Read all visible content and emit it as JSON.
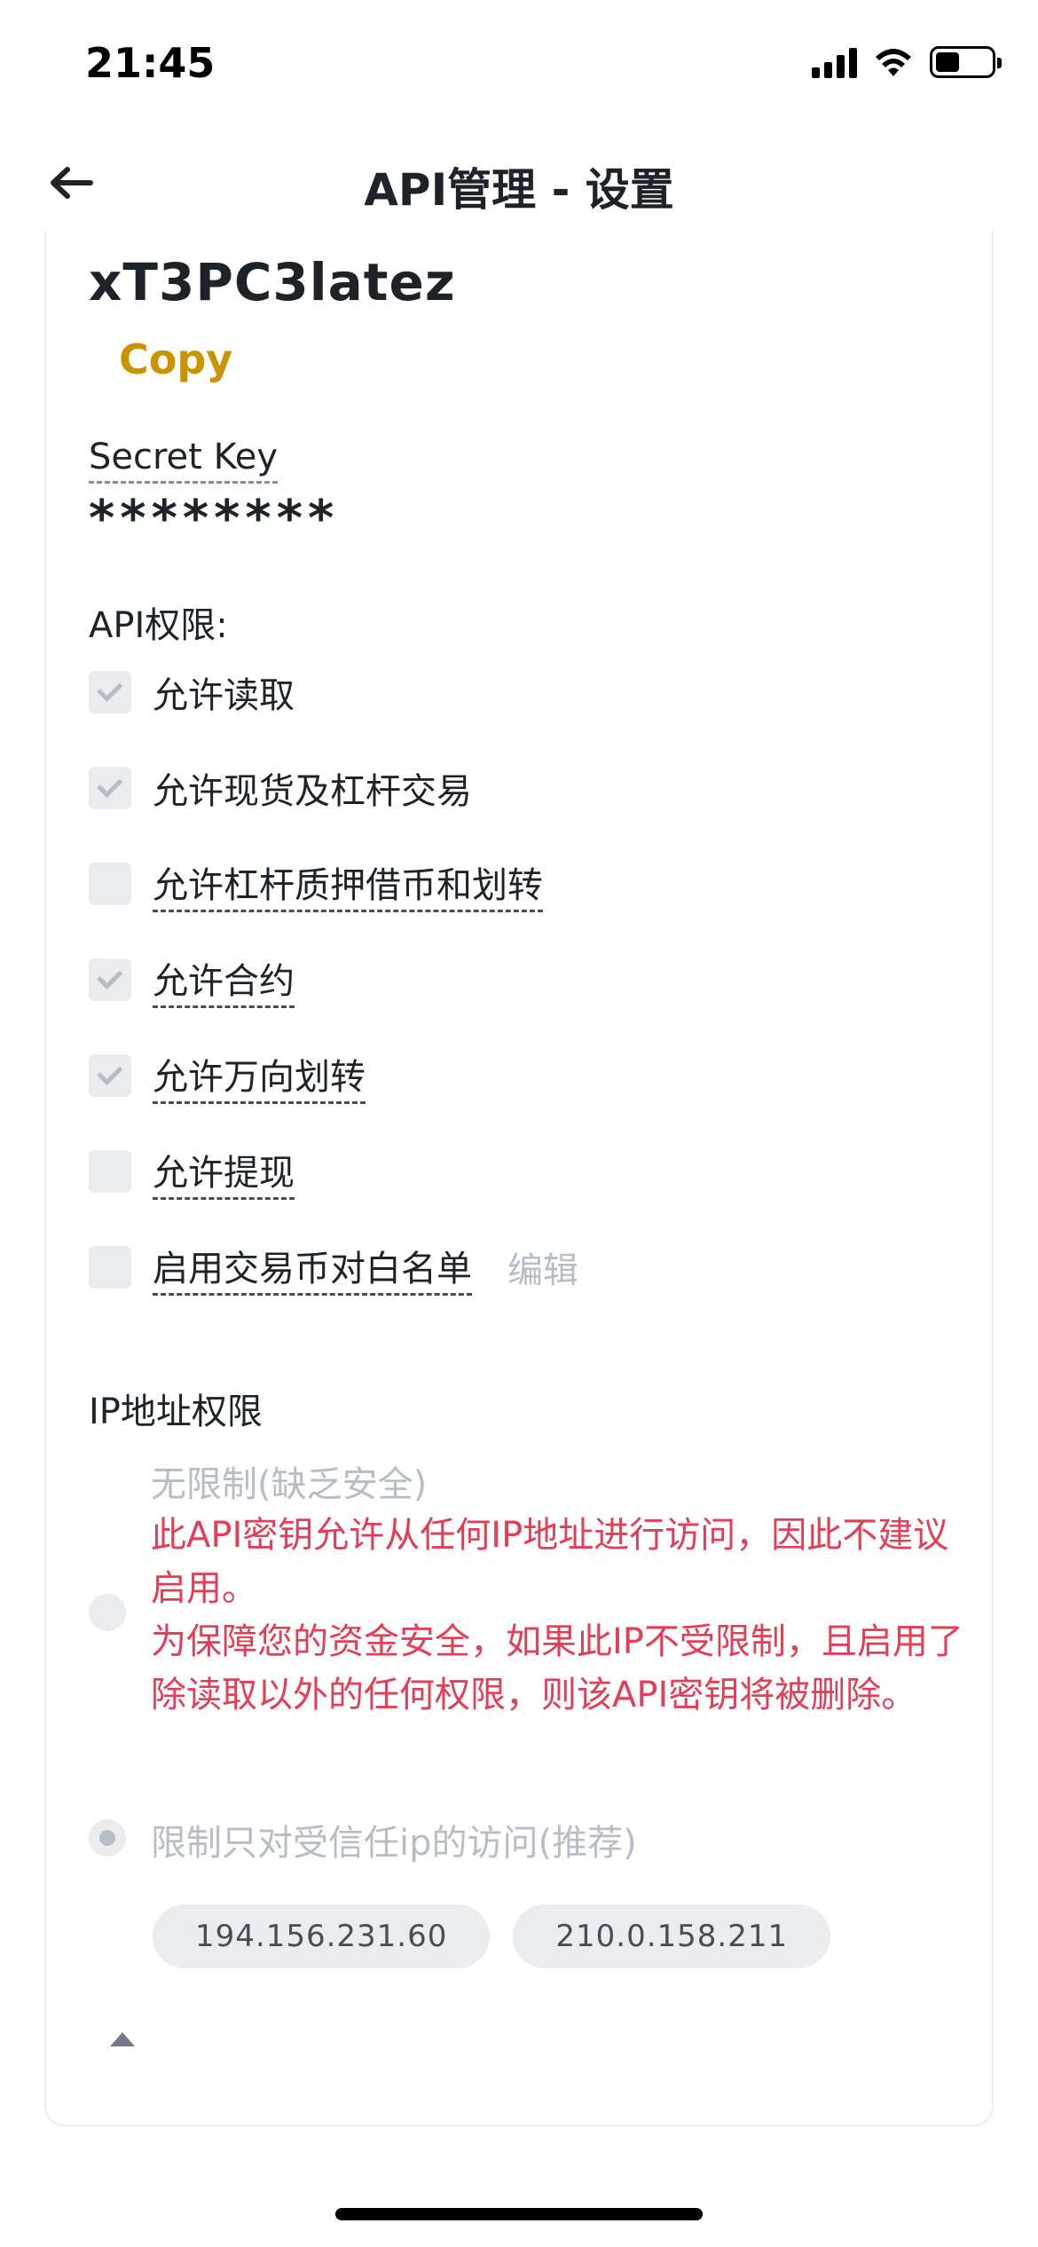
{
  "status_bar": {
    "time": "21:45"
  },
  "header": {
    "title": "API管理 - 设置"
  },
  "api_key": {
    "value": "xT3PC3latez",
    "copy_label": "Copy"
  },
  "secret": {
    "label": "Secret Key",
    "value": "********"
  },
  "permissions": {
    "title": "API权限:",
    "items": [
      {
        "label": "允许读取",
        "checked": true,
        "dashed": false
      },
      {
        "label": "允许现货及杠杆交易",
        "checked": true,
        "dashed": false
      },
      {
        "label": "允许杠杆质押借币和划转",
        "checked": false,
        "dashed": true
      },
      {
        "label": "允许合约",
        "checked": true,
        "dashed": true
      },
      {
        "label": "允许万向划转",
        "checked": true,
        "dashed": true
      },
      {
        "label": "允许提现",
        "checked": false,
        "dashed": true
      },
      {
        "label": "启用交易币对白名单",
        "checked": false,
        "dashed": true
      }
    ],
    "edit_label": "编辑"
  },
  "ip_access": {
    "title": "IP地址权限",
    "unrestricted": {
      "label": "无限制(缺乏安全)",
      "warning_line1": "此API密钥允许从任何IP地址进行访问，因此不建议启用。",
      "warning_line2": "为保障您的资金安全，如果此IP不受限制，且启用了除读取以外的任何权限，则该API密钥将被删除。",
      "selected": false
    },
    "restricted": {
      "label": "限制只对受信任ip的访问(推荐)",
      "selected": true
    },
    "ips": [
      "194.156.231.60",
      "210.0.158.211"
    ]
  },
  "colors": {
    "accent": "#c99400",
    "warning": "#e33e56",
    "muted": "#b7bdc6",
    "text": "#1e2329"
  }
}
